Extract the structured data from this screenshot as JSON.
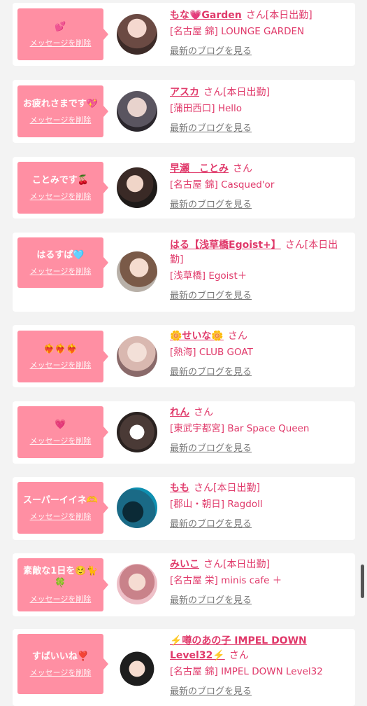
{
  "delete_label": "メッセージを削除",
  "blog_label": "最新のブログを見る",
  "san_label": "さん",
  "colors": {
    "bubble": "#ff8fa3",
    "accent": "#e0396a",
    "card": "#ffffff",
    "page": "#f3f3f3"
  },
  "items": [
    {
      "message": "💕",
      "name": "もな💗Garden",
      "status": "[本日出勤]",
      "shop": "[名古屋 錦] LOUNGE GARDEN"
    },
    {
      "message": "お疲れさまです💖",
      "name": "アスカ",
      "status": "[本日出勤]",
      "shop": "[蒲田西口] Hello"
    },
    {
      "message": "ことみです🍒",
      "name": "早瀬　ことみ",
      "status": "",
      "shop": "[名古屋 錦] Casqued'or"
    },
    {
      "message": "はるすぱ🩵",
      "name": "はる【浅草橋Egoist+】",
      "status": "[本日出勤]",
      "shop": "[浅草橋] Egoist＋"
    },
    {
      "message": "❤️‍🔥❤️‍🔥❤️‍🔥",
      "name": "🌼せいな🌼",
      "status": "",
      "shop": "[熱海] CLUB GOAT"
    },
    {
      "message": "💗",
      "name": "れん",
      "status": "",
      "shop": "[東武宇都宮] Bar Space Queen"
    },
    {
      "message": "スーパーイイネ🫶",
      "name": "もも",
      "status": "[本日出勤]",
      "shop": "[郡山・朝日] Ragdoll"
    },
    {
      "message": "素敵な1日を☺️🐈🍀",
      "name": "みいこ",
      "status": "[本日出勤]",
      "shop": "[名古屋 栄] minis cafe ＋"
    },
    {
      "message": "すばいいね❣️",
      "name": "⚡️噂のあの子 IMPEL DOWN Level32⚡️",
      "status": "",
      "shop": "[名古屋 錦] IMPEL DOWN Level32"
    }
  ]
}
